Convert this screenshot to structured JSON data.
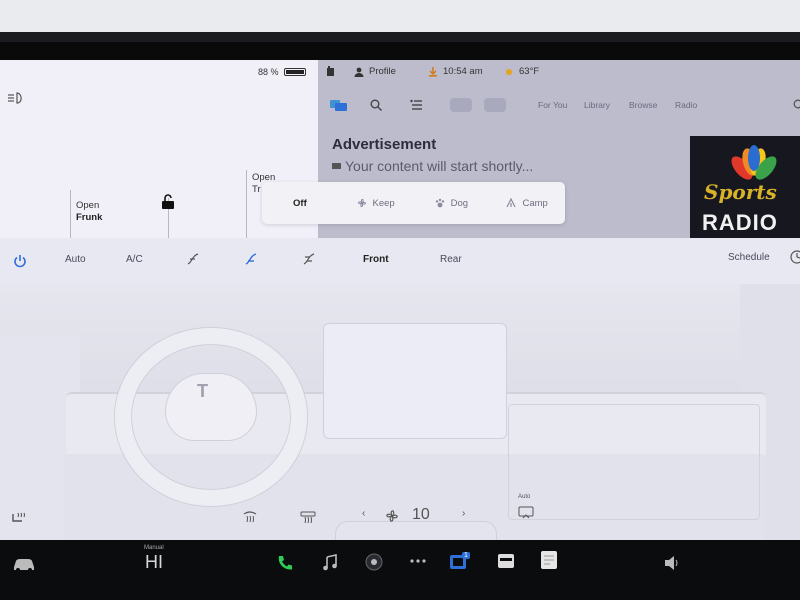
{
  "status": {
    "battery_percent": "88 %",
    "battery_level": 0.88,
    "profile_label": "Profile",
    "time": "10:54 am",
    "temperature": "63°F"
  },
  "car": {
    "frunk_action": "Open",
    "frunk_label": "Frunk",
    "trunk_action": "Open",
    "trunk_label_partial": "Tr"
  },
  "media": {
    "nav_items": [
      "For You",
      "Library",
      "Browse",
      "Radio"
    ],
    "ad_title": "Advertisement",
    "ad_subtitle": "Your content will start shortly...",
    "album_line1": "Sports",
    "album_line2": "RADIO"
  },
  "climate_keeper": {
    "options": [
      "Off",
      "Keep",
      "Dog",
      "Camp"
    ],
    "selected": "Off"
  },
  "climate": {
    "auto_label": "Auto",
    "ac_label": "A/C",
    "front_label": "Front",
    "rear_label": "Rear",
    "schedule_label": "Schedule",
    "fan_speed": "10",
    "auto_small_label": "Auto"
  },
  "dock": {
    "drive_mode_small": "Manual",
    "drive_mode_value": "HI",
    "apps_badge": "1"
  },
  "colors": {
    "accent": "#2f6fd8",
    "phone_green": "#2ecc55"
  }
}
